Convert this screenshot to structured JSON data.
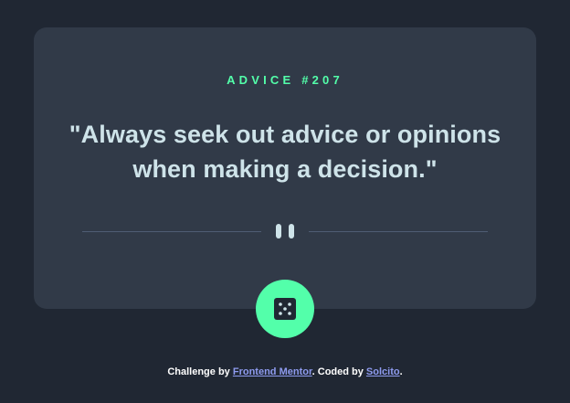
{
  "card": {
    "advice_id": "ADVICE #207",
    "quote": "\"Always seek out advice or opinions when making a decision.\""
  },
  "divider": {
    "icon": "pause-icon"
  },
  "dice_button": {
    "icon": "dice-icon"
  },
  "attribution": {
    "prefix": "Challenge by ",
    "link1": "Frontend Mentor",
    "middle": ". Coded by ",
    "link2": "Solcito",
    "suffix": "."
  },
  "colors": {
    "background": "#202733",
    "card": "#313a48",
    "accent": "#53ffaa",
    "text": "#cee3e9",
    "link": "#8e9bef",
    "divider": "#4f5d74"
  }
}
